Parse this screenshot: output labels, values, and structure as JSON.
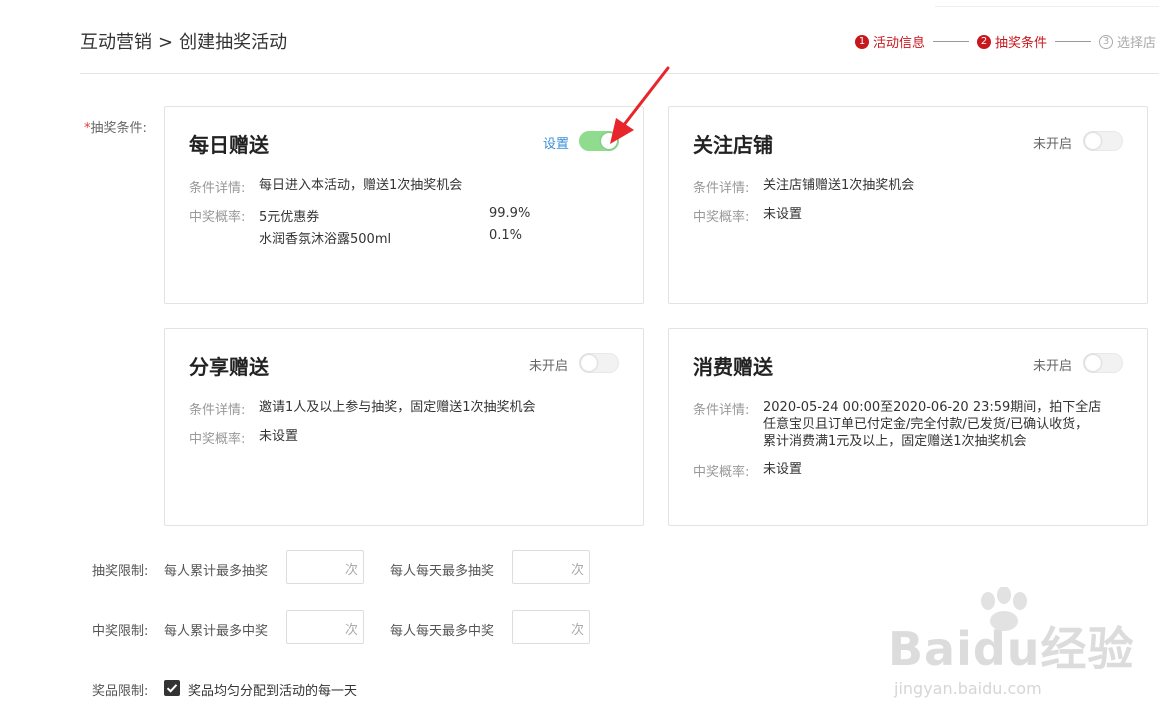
{
  "breadcrumb": {
    "parent": "互动营销",
    "separator": ">",
    "current": "创建抽奖活动"
  },
  "steps": [
    {
      "num": "1",
      "label": "活动信息",
      "active": true
    },
    {
      "num": "2",
      "label": "抽奖条件",
      "active": true
    },
    {
      "num": "3",
      "label": "选择店",
      "active": false
    }
  ],
  "conditions_label": "抽奖条件:",
  "field_labels": {
    "detail": "条件详情:",
    "prob": "中奖概率:"
  },
  "cards": [
    {
      "title": "每日赠送",
      "status": "设置",
      "enabled": true,
      "detail": "每日进入本活动，赠送1次抽奖机会",
      "prizes": [
        {
          "name": "5元优惠券",
          "rate": "99.9%"
        },
        {
          "name": "水润香氛沐浴露500ml",
          "rate": "0.1%"
        }
      ]
    },
    {
      "title": "关注店铺",
      "status": "未开启",
      "enabled": false,
      "detail": "关注店铺赠送1次抽奖机会",
      "prob": "未设置"
    },
    {
      "title": "分享赠送",
      "status": "未开启",
      "enabled": false,
      "detail": "邀请1人及以上参与抽奖，固定赠送1次抽奖机会",
      "prob": "未设置"
    },
    {
      "title": "消费赠送",
      "status": "未开启",
      "enabled": false,
      "detail_lines": [
        "2020-05-24 00:00至2020-06-20 23:59期间，拍下全店",
        "任意宝贝且订单已付定金/完全付款/已发货/已确认收货，",
        "累计消费满1元及以上，固定赠送1次抽奖机会"
      ],
      "prob": "未设置"
    }
  ],
  "draw_limit": {
    "label": "抽奖限制:",
    "total": "每人累计最多抽奖",
    "daily": "每人每天最多抽奖",
    "unit": "次"
  },
  "win_limit": {
    "label": "中奖限制:",
    "total": "每人累计最多中奖",
    "daily": "每人每天最多中奖",
    "unit": "次"
  },
  "prize_limit": {
    "label": "奖品限制:",
    "checkbox_label": "奖品均匀分配到活动的每一天",
    "checked": true
  },
  "watermark": {
    "brand": "Baidu经验",
    "url": "jingyan.baidu.com"
  },
  "colors": {
    "accent_red": "#c8161d",
    "toggle_on": "#8fdc8f",
    "link_blue": "#3b8fd8",
    "arrow_red": "#e8252b"
  }
}
